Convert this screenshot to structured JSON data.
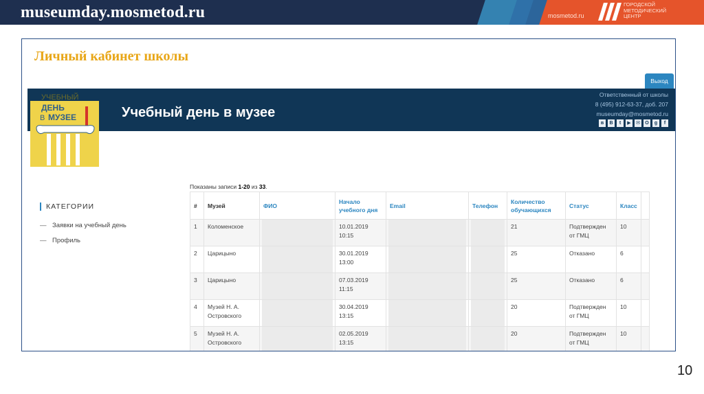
{
  "slide": {
    "title": "museumday.mosmetod.ru",
    "brand_site": "mosmetod.ru",
    "brand_text": "ГОРОДСКОЙ МЕТОДИЧЕСКИЙ ЦЕНТР",
    "page_number": "10"
  },
  "cabinet": {
    "title": "Личный кабинет школы",
    "exit_label": "Выход"
  },
  "site": {
    "name": "Учебный день в музее",
    "contact_label": "Ответственный от школы",
    "contact_phone": "8 (495) 912-63-37, доб. 207",
    "contact_email": "museumday@mosmetod.ru",
    "socials": [
      "в",
      "В",
      "t",
      "▶",
      "✉",
      "О",
      "g",
      "f"
    ],
    "logo_text": [
      "УЧЕБНЫЙ",
      "ДЕНЬ",
      "В",
      "МУЗЕЕ"
    ]
  },
  "sidebar": {
    "heading": "КАТЕГОРИИ",
    "items": [
      {
        "label": "Заявки на учебный день"
      },
      {
        "label": "Профиль"
      }
    ]
  },
  "table": {
    "records_prefix": "Показаны записи ",
    "records_range": "1-20",
    "records_mid": " из ",
    "records_total": "33",
    "records_suffix": ".",
    "columns": [
      "#",
      "Музей",
      "ФИО",
      "Начало учебного дня",
      "Email",
      "Телефон",
      "Количество обучающихся",
      "Статус",
      "Класс"
    ],
    "rows": [
      {
        "num": "1",
        "museum": "Коломенское",
        "date": "10.01.2019",
        "time": "10:15",
        "count": "21",
        "status": "Подтвержден от ГМЦ",
        "grade": "10"
      },
      {
        "num": "2",
        "museum": "Царицыно",
        "date": "30.01.2019",
        "time": "13:00",
        "count": "25",
        "status": "Отказано",
        "grade": "6"
      },
      {
        "num": "3",
        "museum": "Царицыно",
        "date": "07.03.2019",
        "time": "11:15",
        "count": "25",
        "status": "Отказано",
        "grade": "6"
      },
      {
        "num": "4",
        "museum": "Музей Н. А. Островского",
        "date": "30.04.2019",
        "time": "13:15",
        "count": "20",
        "status": "Подтвержден от ГМЦ",
        "grade": "10"
      },
      {
        "num": "5",
        "museum": "Музей Н. А. Островского",
        "date": "02.05.2019",
        "time": "13:15",
        "count": "20",
        "status": "Подтвержден от ГМЦ",
        "grade": "10"
      }
    ]
  },
  "colors": {
    "banner": "#1e2f4f",
    "accent_orange": "#e5542b",
    "cabinet_title": "#e8a617",
    "site_header": "#103656",
    "link_blue": "#2c86c0",
    "logo_yellow": "#efd34a"
  }
}
